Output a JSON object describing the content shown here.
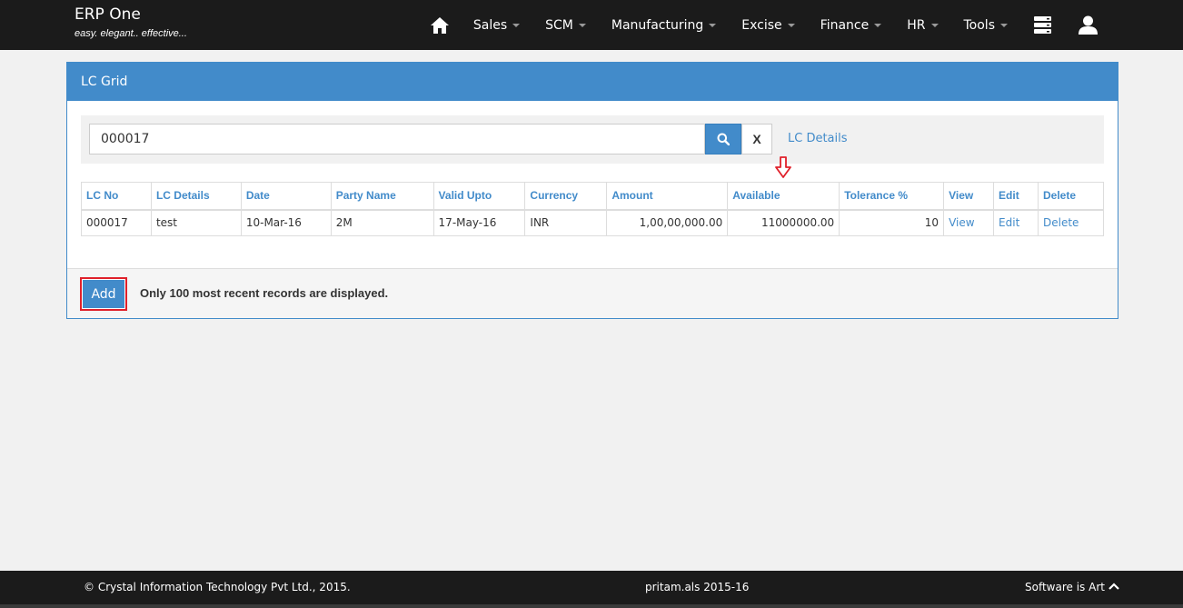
{
  "app": {
    "title": "ERP One",
    "tagline": "easy. elegant.. effective..."
  },
  "nav": {
    "items": [
      {
        "label": "Sales"
      },
      {
        "label": "SCM"
      },
      {
        "label": "Manufacturing"
      },
      {
        "label": "Excise"
      },
      {
        "label": "Finance"
      },
      {
        "label": "HR"
      },
      {
        "label": "Tools"
      }
    ],
    "icons": [
      "home-icon",
      "server-icon",
      "user-icon"
    ]
  },
  "panel": {
    "title": "LC Grid",
    "search": {
      "value": "000017",
      "clear_label": "X",
      "link_label": "LC Details"
    },
    "table": {
      "headers": [
        "LC No",
        "LC Details",
        "Date",
        "Party Name",
        "Valid Upto",
        "Currency",
        "Amount",
        "Available",
        "Tolerance %",
        "View",
        "Edit",
        "Delete"
      ],
      "rows": [
        {
          "lc_no": "000017",
          "lc_details": "test",
          "date": "10-Mar-16",
          "party_name": "2M",
          "valid_upto": "17-May-16",
          "currency": "INR",
          "amount": "1,00,00,000.00",
          "available": "11000000.00",
          "tolerance": "10",
          "view": "View",
          "edit": "Edit",
          "delete": "Delete"
        }
      ]
    },
    "footer": {
      "add_label": "Add",
      "note": "Only 100 most recent records are displayed."
    }
  },
  "footer": {
    "copyright": "© Crystal Information Technology Pvt Ltd., 2015.",
    "user": "pritam.als 2015-16",
    "slogan": "Software is Art"
  },
  "colors": {
    "primary": "#428bca",
    "navbar": "#1b1b1b",
    "highlight": "#e0202a"
  }
}
